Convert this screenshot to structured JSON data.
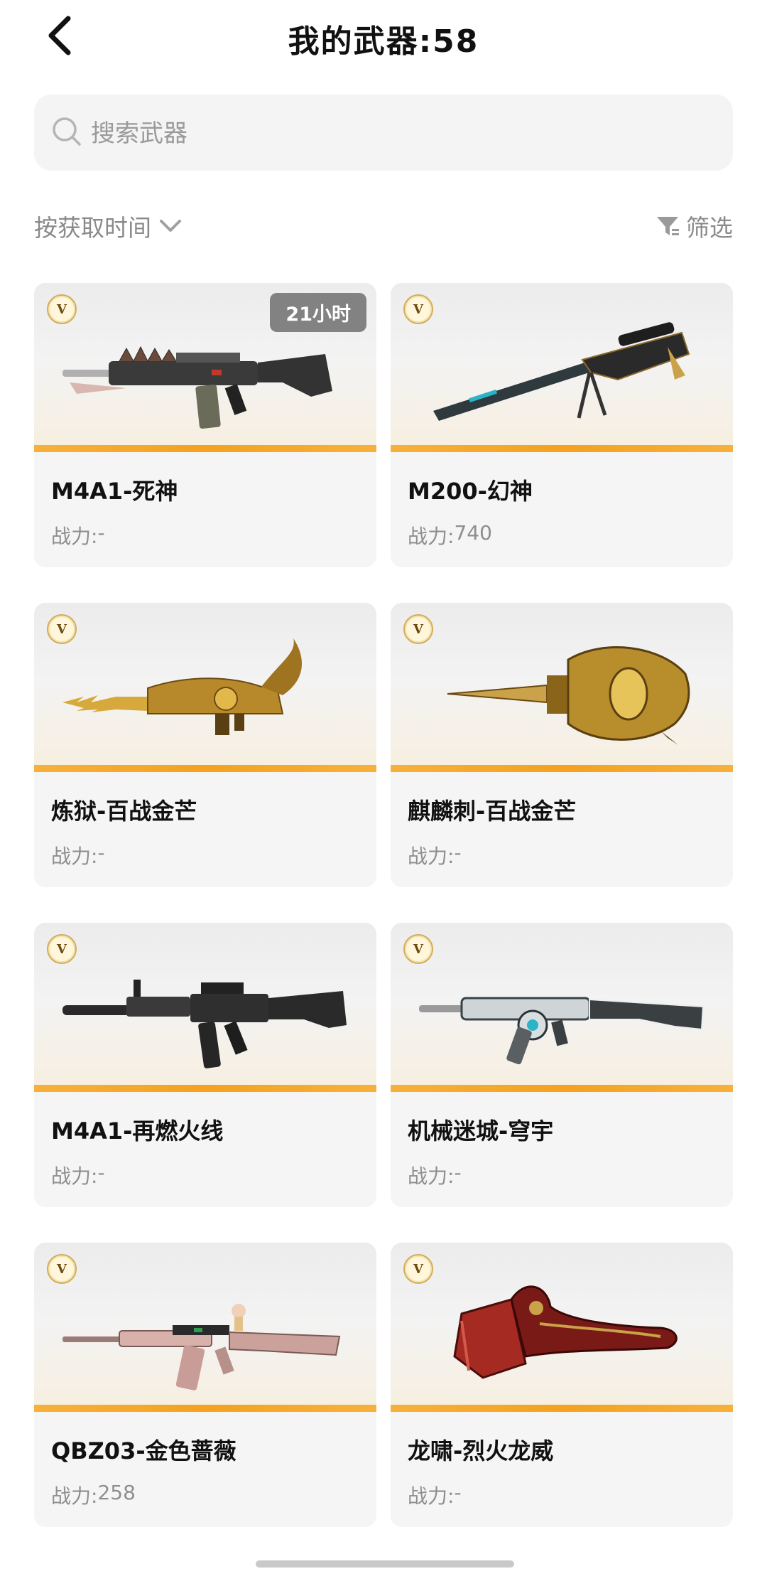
{
  "header": {
    "title": "我的武器:58",
    "back_icon": "back-chevron-icon"
  },
  "search": {
    "placeholder": "搜索武器",
    "icon": "search-icon"
  },
  "toolbar": {
    "sort_label": "按获取时间",
    "sort_icon": "chevron-down-icon",
    "filter_label": "筛选",
    "filter_icon": "funnel-filter-icon"
  },
  "weapons": [
    {
      "name": "M4A1-死神",
      "power_label": "战力:",
      "power_value": "-",
      "time_badge": "21小时",
      "badge": "V"
    },
    {
      "name": "M200-幻神",
      "power_label": "战力:",
      "power_value": "740",
      "badge": "V"
    },
    {
      "name": "炼狱-百战金芒",
      "power_label": "战力:",
      "power_value": "-",
      "badge": "V"
    },
    {
      "name": "麒麟刺-百战金芒",
      "power_label": "战力:",
      "power_value": "-",
      "badge": "V"
    },
    {
      "name": "M4A1-再燃火线",
      "power_label": "战力:",
      "power_value": "-",
      "badge": "V"
    },
    {
      "name": "机械迷城-穹宇",
      "power_label": "战力:",
      "power_value": "-",
      "badge": "V"
    },
    {
      "name": "QBZ03-金色蔷薇",
      "power_label": "战力:",
      "power_value": "258",
      "badge": "V"
    },
    {
      "name": "龙啸-烈火龙威",
      "power_label": "战力:",
      "power_value": "-",
      "badge": "V"
    }
  ],
  "colors": {
    "accent_orange": "#f4a21f",
    "muted_text": "#8a8a8a",
    "card_bg": "#f5f5f5"
  }
}
